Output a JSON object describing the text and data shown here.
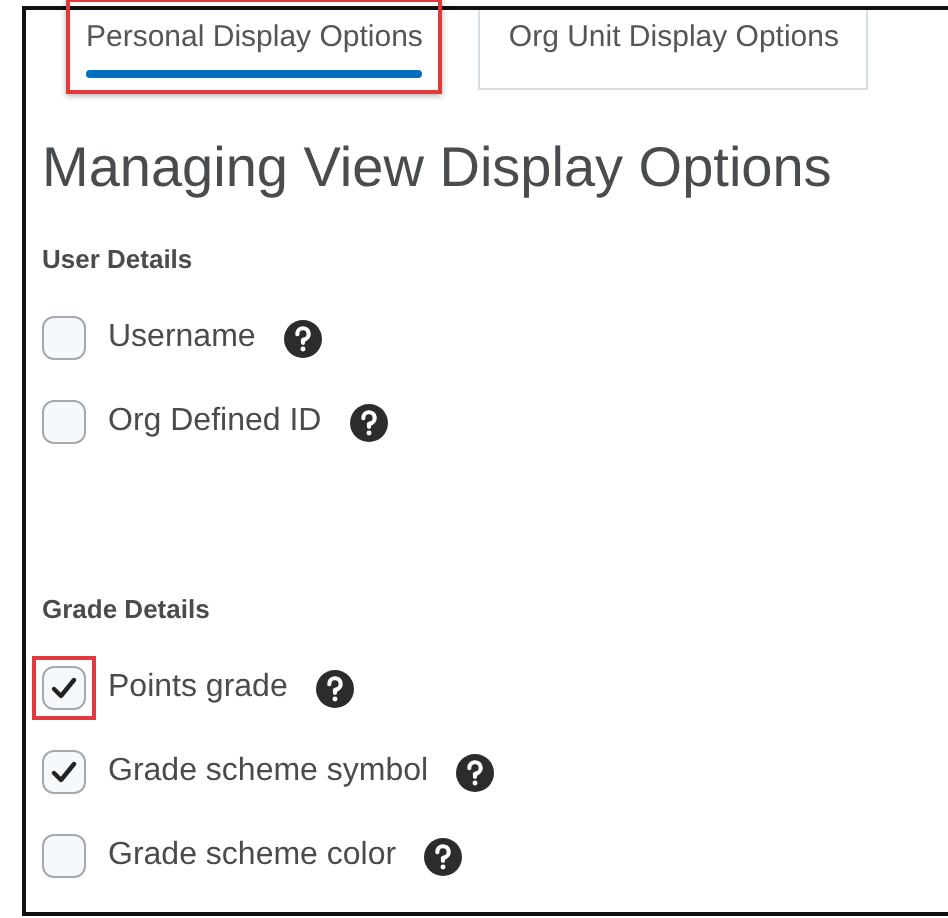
{
  "tabs": [
    {
      "label": "Personal Display Options",
      "selected": true,
      "highlighted": true
    },
    {
      "label": "Org Unit Display Options",
      "selected": false,
      "highlighted": false
    }
  ],
  "title": "Managing View Display Options",
  "sections": [
    {
      "heading": "User Details",
      "options": [
        {
          "label": "Username",
          "checked": false,
          "highlighted": false
        },
        {
          "label": "Org Defined ID",
          "checked": false,
          "highlighted": false
        }
      ]
    },
    {
      "heading": "Grade Details",
      "options": [
        {
          "label": "Points grade",
          "checked": true,
          "highlighted": true
        },
        {
          "label": "Grade scheme symbol",
          "checked": true,
          "highlighted": false
        },
        {
          "label": "Grade scheme color",
          "checked": false,
          "highlighted": false
        }
      ]
    }
  ]
}
